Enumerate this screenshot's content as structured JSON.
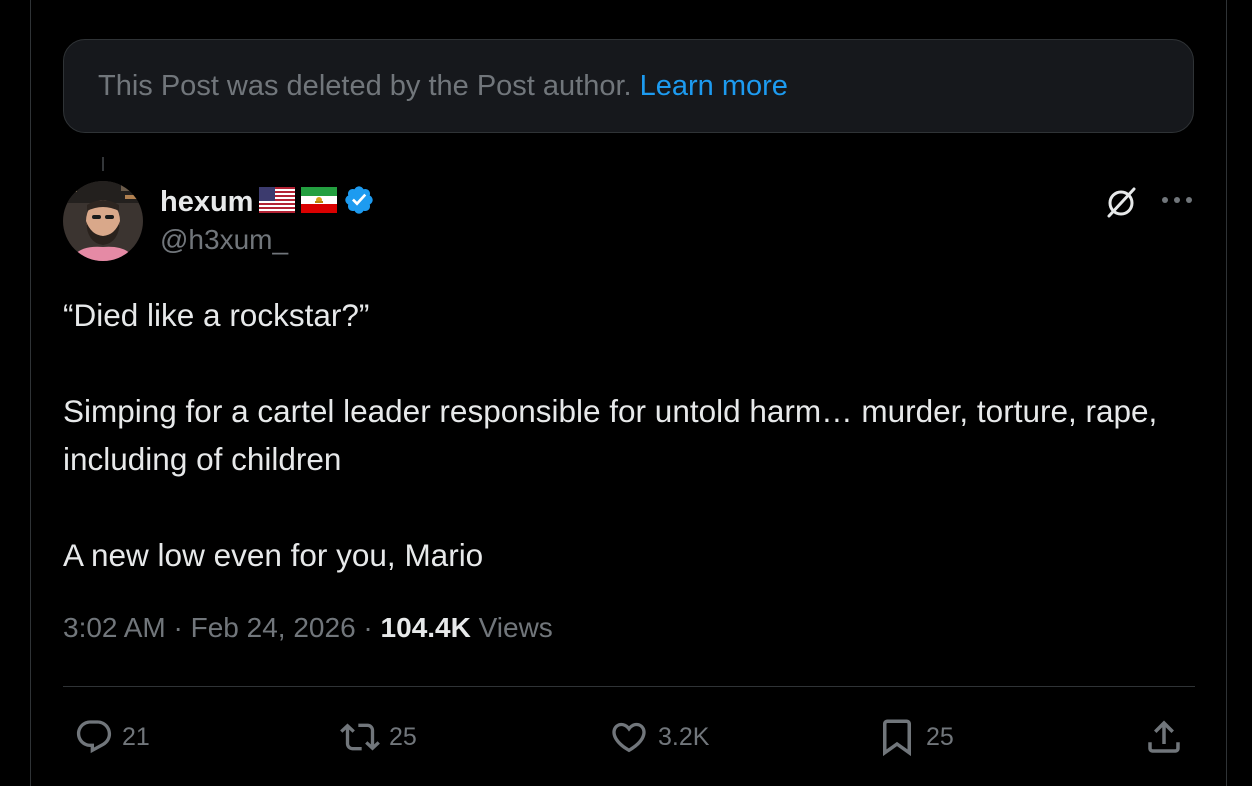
{
  "deleted_notice": {
    "text": "This Post was deleted by the Post author.",
    "link": "Learn more"
  },
  "author": {
    "display_name": "hexum",
    "handle": "@h3xum_",
    "flags": [
      "us-flag-icon",
      "iran-lion-and-sun-flag-icon"
    ],
    "verified": true
  },
  "tweet": {
    "lines": [
      "“Died like a rockstar?”",
      "Simping for a cartel leader responsible for untold harm… murder, torture, rape, including of children",
      "A new low even for you, Mario"
    ]
  },
  "meta": {
    "time": "3:02 AM",
    "separator": " · ",
    "date": "Feb 24, 2026",
    "views_count": "104.4K",
    "views_label": "Views"
  },
  "actions": {
    "replies": "21",
    "reposts": "25",
    "likes": "3.2K",
    "bookmarks": "25"
  },
  "icons": {
    "grok": "grok-icon",
    "more": "more-icon",
    "reply": "reply-icon",
    "repost": "repost-icon",
    "like": "heart-icon",
    "bookmark": "bookmark-icon",
    "share": "share-icon"
  },
  "colors": {
    "background": "#000000",
    "text": "#e7e9ea",
    "muted": "#71767b",
    "accent": "#1d9bf0",
    "border": "#2f3336"
  }
}
